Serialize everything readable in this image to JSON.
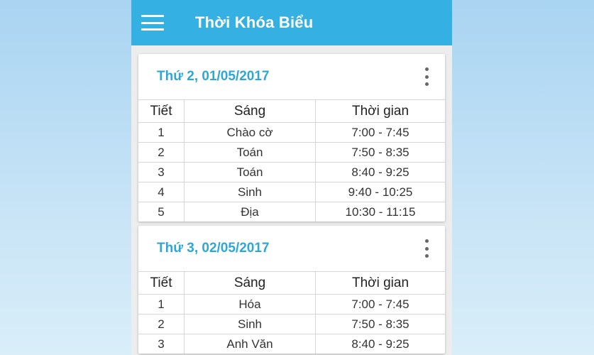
{
  "app": {
    "title": "Thời Khóa Biểu"
  },
  "table_headers": {
    "period": "Tiết",
    "morning": "Sáng",
    "time": "Thời gian"
  },
  "days": [
    {
      "title": "Thứ 2, 01/05/2017",
      "rows": [
        {
          "period": "1",
          "subject": "Chào cờ",
          "time": "7:00 - 7:45"
        },
        {
          "period": "2",
          "subject": "Toán",
          "time": "7:50 - 8:35"
        },
        {
          "period": "3",
          "subject": "Toán",
          "time": "8:40 - 9:25"
        },
        {
          "period": "4",
          "subject": "Sinh",
          "time": "9:40 - 10:25"
        },
        {
          "period": "5",
          "subject": "Địa",
          "time": "10:30 - 11:15"
        }
      ]
    },
    {
      "title": "Thứ 3, 02/05/2017",
      "rows": [
        {
          "period": "1",
          "subject": "Hóa",
          "time": "7:00 - 7:45"
        },
        {
          "period": "2",
          "subject": "Sinh",
          "time": "7:50 - 8:35"
        },
        {
          "period": "3",
          "subject": "Anh Văn",
          "time": "8:40 - 9:25"
        }
      ]
    }
  ],
  "colors": {
    "appbar": "#34b1e2",
    "card_title": "#2ea7d6",
    "background": "#ededed"
  }
}
